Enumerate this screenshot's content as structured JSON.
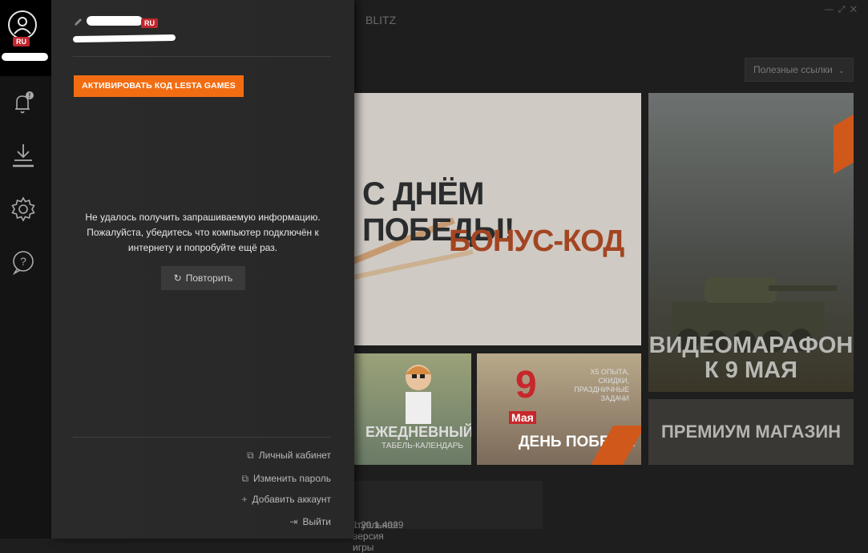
{
  "colors": {
    "accent": "#f26d12",
    "badge": "#c0272d",
    "panel": "#282828",
    "rail": "#141414"
  },
  "rail": {
    "region_badge": "RU",
    "icons": [
      "user-icon",
      "bell-icon",
      "download-icon",
      "gear-icon",
      "help-icon"
    ]
  },
  "background": {
    "app_title": "BLITZ",
    "useful_links": "Полезные ссылки",
    "tiles": {
      "main_line1": "С ДНЁМ ПОБЕДЫ!",
      "main_line2": "БОНУС-КОД",
      "tank_line1": "ВИДЕОМАРАФОН",
      "tank_line2": "К 9 МАЯ",
      "daily_title": "ЕЖЕДНЕВНЫЙ",
      "daily_subtitle": "ТАБЕЛЬ-КАЛЕНДАРЬ",
      "victory_number": "9",
      "victory_month": "Мая",
      "victory_note": "X5 ОПЫТА, СКИДКИ, ПРАЗДНИЧНЫЕ ЗАДАЧИ",
      "victory_title": "ДЕНЬ ПОБЕДЫ",
      "shop_title": "ПРЕМИУМ МАГАЗИН"
    },
    "version_label": "ктуальная версия игры",
    "version_number": "1.20.1.4029"
  },
  "panel": {
    "region_badge": "RU",
    "activate_button": "АКТИВИРОВАТЬ КОД LESTA GAMES",
    "error_lines": [
      "Не удалось получить запрашиваемую информацию.",
      "Пожалуйста, убедитесь что компьютер подключён к",
      "интернету и попробуйте ещё раз."
    ],
    "retry_button": "Повторить",
    "links": {
      "account": "Личный кабинет",
      "change_password": "Изменить пароль",
      "add_account": "Добавить аккаунт",
      "logout": "Выйти"
    }
  }
}
